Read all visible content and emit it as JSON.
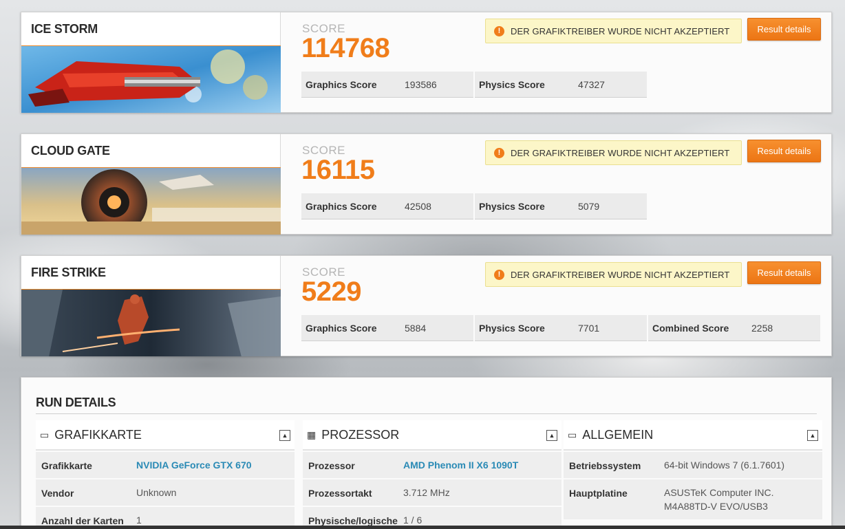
{
  "tests": [
    {
      "name": "ICE STORM",
      "score_label": "SCORE",
      "score": "114768",
      "warning": "DER GRAFIKTREIBER WURDE NICHT AKZEPTIERT",
      "details_label": "Result details",
      "metrics": [
        {
          "label": "Graphics Score",
          "value": "193586"
        },
        {
          "label": "Physics Score",
          "value": "47327"
        }
      ]
    },
    {
      "name": "CLOUD GATE",
      "score_label": "SCORE",
      "score": "16115",
      "warning": "DER GRAFIKTREIBER WURDE NICHT AKZEPTIERT",
      "details_label": "Result details",
      "metrics": [
        {
          "label": "Graphics Score",
          "value": "42508"
        },
        {
          "label": "Physics Score",
          "value": "5079"
        }
      ]
    },
    {
      "name": "FIRE STRIKE",
      "score_label": "SCORE",
      "score": "5229",
      "warning": "DER GRAFIKTREIBER WURDE NICHT AKZEPTIERT",
      "details_label": "Result details",
      "metrics": [
        {
          "label": "Graphics Score",
          "value": "5884"
        },
        {
          "label": "Physics Score",
          "value": "7701"
        },
        {
          "label": "Combined Score",
          "value": "2258"
        }
      ]
    }
  ],
  "colors": {
    "accent": "#f07d1a",
    "warning_bg": "#fcf6c8",
    "link": "#2a8ab5"
  },
  "run_details": {
    "title": "RUN DETAILS",
    "panels": [
      {
        "title": "GRAFIKKARTE",
        "icon": "monitor-icon",
        "rows": [
          {
            "label": "Grafikkarte",
            "value": "NVIDIA GeForce GTX 670"
          },
          {
            "label": "Vendor",
            "value": "Unknown"
          },
          {
            "label": "Anzahl der Karten",
            "value": "1"
          }
        ]
      },
      {
        "title": "PROZESSOR",
        "icon": "cpu-icon",
        "rows": [
          {
            "label": "Prozessor",
            "value": "AMD Phenom II X6 1090T"
          },
          {
            "label": "Prozessortakt",
            "value": "3.712 MHz"
          },
          {
            "label": "Physische/logische",
            "value": "1 / 6"
          }
        ]
      },
      {
        "title": "ALLGEMEIN",
        "icon": "laptop-icon",
        "rows": [
          {
            "label": "Betriebssystem",
            "value": "64-bit Windows 7 (6.1.7601)"
          },
          {
            "label": "Hauptplatine",
            "value_line1": "ASUSTeK Computer INC.",
            "value_line2": "M4A88TD-V EVO/USB3"
          }
        ]
      }
    ]
  }
}
